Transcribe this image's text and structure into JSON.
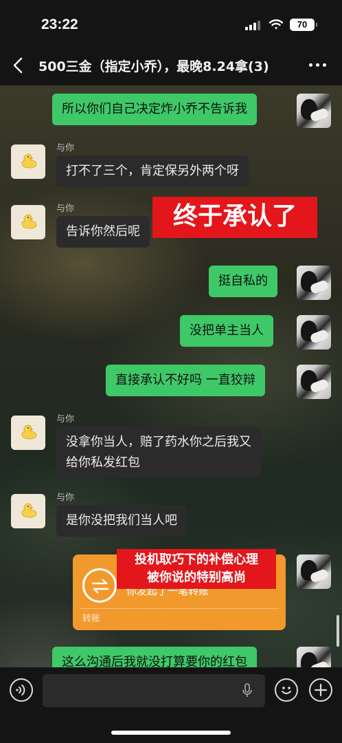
{
  "status_bar": {
    "time": "23:22",
    "battery": "70"
  },
  "header": {
    "title": "500三金（指定小乔），最晚8.24拿(3)"
  },
  "messages": [
    {
      "side": "right",
      "text": "所以你们自己决定炸小乔不告诉我"
    },
    {
      "side": "left",
      "sender": "与你",
      "text": "打不了三个，肯定保另外两个呀"
    },
    {
      "side": "left",
      "sender": "与你",
      "text": "告诉你然后呢"
    },
    {
      "side": "right",
      "text": "挺自私的"
    },
    {
      "side": "right",
      "text": "没把单主当人"
    },
    {
      "side": "right",
      "text": "直接承认不好吗 一直狡辩"
    },
    {
      "side": "left",
      "sender": "与你",
      "text_line1": "没拿你当人，赔了药水你之后我又",
      "text_line2": "给你私发红包"
    },
    {
      "side": "left",
      "sender": "与你",
      "text": "是你没把我们当人吧"
    },
    {
      "side": "right",
      "type": "transfer",
      "desc": "你发起了一笔转账",
      "label": "转账"
    },
    {
      "side": "right",
      "text": "这么沟通后我就没打算要你的红包"
    }
  ],
  "overlays": {
    "sticker_big": "终于承认了",
    "sticker_small_line1": "投机取巧下的补偿心理",
    "sticker_small_line2": "被你说的特别高尚"
  },
  "colors": {
    "bubble_self": "#3fc868",
    "bubble_other": "#2b2b2b",
    "sticker": "#e3161b",
    "transfer": "#f2992e"
  },
  "icons": [
    "back-icon",
    "more-icon",
    "voice-icon",
    "mic-icon",
    "emoji-icon",
    "plus-icon",
    "transfer-icon",
    "duck-icon"
  ]
}
